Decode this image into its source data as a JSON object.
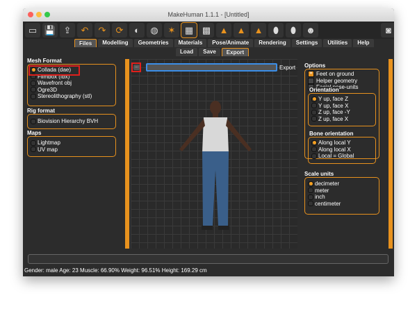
{
  "window": {
    "title": "MakeHuman 1.1.1 - [Untitled]"
  },
  "toolbar": [
    "new-icon",
    "save-icon",
    "export-icon",
    "undo-icon",
    "redo-icon",
    "reset-icon",
    "smooth-icon",
    "wireframe-icon",
    "pose-icon",
    "grid-icon",
    "checker-icon",
    "front-view-icon",
    "back-view-icon",
    "side-view-icon",
    "face-front-icon",
    "face-side-icon",
    "head-icon",
    "screenshot-icon"
  ],
  "tabs": [
    "Files",
    "Modelling",
    "Geometries",
    "Materials",
    "Pose/Animate",
    "Rendering",
    "Settings",
    "Utilities",
    "Help"
  ],
  "subtabs": [
    "Load",
    "Save",
    "Export"
  ],
  "left": {
    "mesh_format": {
      "title": "Mesh Format",
      "items": [
        "Collada (dae)",
        "Filmbox (fbx)",
        "Wavefront obj",
        "Ogre3D",
        "Stereolithography (stl)"
      ],
      "selected": 0
    },
    "rig_format": {
      "title": "Rig format",
      "items": [
        "Biovision Hierarchy BVH"
      ]
    },
    "maps": {
      "title": "Maps",
      "items": [
        "Lightmap",
        "UV map"
      ]
    }
  },
  "export": {
    "browse_label": "...",
    "path_value": "",
    "button_label": "Export"
  },
  "right": {
    "options": {
      "title": "Options",
      "items": [
        {
          "label": "Feet on ground",
          "checked": true
        },
        {
          "label": "Helper geometry",
          "checked": false
        },
        {
          "label": "Facial pose-units",
          "checked": false
        }
      ]
    },
    "orientation": {
      "title": "Orientation",
      "items": [
        "Y up, face Z",
        "Y up, face X",
        "Z up, face -Y",
        "Z up, face X"
      ],
      "selected": 0
    },
    "bone_orientation": {
      "title": "Bone orientation",
      "items": [
        "Along local Y",
        "Along local X",
        "Local = Global"
      ],
      "selected": 0
    },
    "scale_units": {
      "title": "Scale units",
      "items": [
        "decimeter",
        "meter",
        "inch",
        "centimeter"
      ],
      "selected": 0
    }
  },
  "status": "Gender: male Age: 23 Muscle: 66.90% Weight: 96.51% Height: 169.29 cm"
}
